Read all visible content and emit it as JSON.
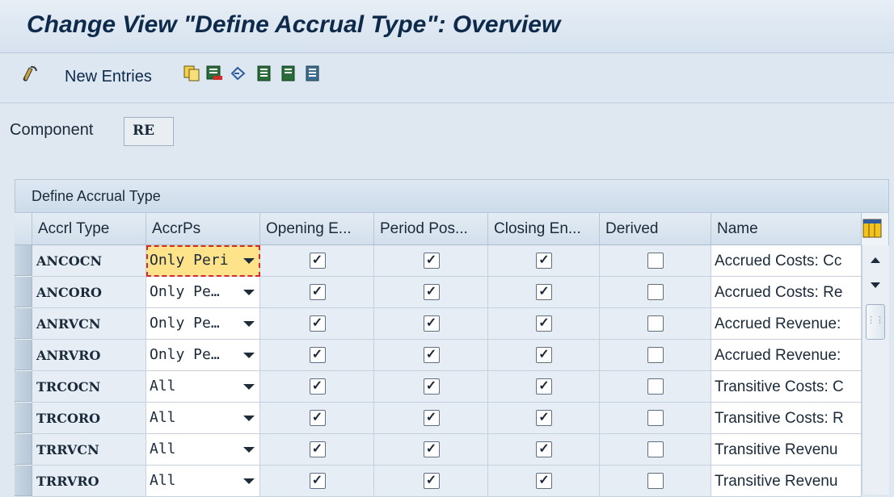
{
  "window": {
    "title": "Change View \"Define Accrual Type\": Overview"
  },
  "toolbar": {
    "new_entries_label": "New Entries",
    "icons": [
      "change-display-icon",
      "copy-icon",
      "delete-icon",
      "undo-change-icon",
      "select-all-icon",
      "select-block-icon",
      "deselect-all-icon"
    ]
  },
  "component": {
    "label": "Component",
    "value": "RE"
  },
  "table": {
    "title": "Define Accrual Type",
    "columns": [
      "Accrl Type",
      "AccrPs",
      "Opening E...",
      "Period Pos...",
      "Closing En...",
      "Derived",
      "Name"
    ],
    "rows": [
      {
        "type": "ANCOCN",
        "accrps": "Only Peri",
        "opening": true,
        "period": true,
        "closing": true,
        "derived": false,
        "name": "Accrued Costs: Cc"
      },
      {
        "type": "ANCORO",
        "accrps": "Only Pe…",
        "opening": true,
        "period": true,
        "closing": true,
        "derived": false,
        "name": "Accrued Costs: Re"
      },
      {
        "type": "ANRVCN",
        "accrps": "Only Pe…",
        "opening": true,
        "period": true,
        "closing": true,
        "derived": false,
        "name": "Accrued Revenue:"
      },
      {
        "type": "ANRVRO",
        "accrps": "Only Pe…",
        "opening": true,
        "period": true,
        "closing": true,
        "derived": false,
        "name": "Accrued Revenue:"
      },
      {
        "type": "TRCOCN",
        "accrps": "All",
        "opening": true,
        "period": true,
        "closing": true,
        "derived": false,
        "name": "Transitive Costs: C"
      },
      {
        "type": "TRCORO",
        "accrps": "All",
        "opening": true,
        "period": true,
        "closing": true,
        "derived": false,
        "name": "Transitive Costs: R"
      },
      {
        "type": "TRRVCN",
        "accrps": "All",
        "opening": true,
        "period": true,
        "closing": true,
        "derived": false,
        "name": "Transitive Revenu"
      },
      {
        "type": "TRRVRO",
        "accrps": "All",
        "opening": true,
        "period": true,
        "closing": true,
        "derived": false,
        "name": "Transitive Revenu"
      }
    ]
  },
  "colors": {
    "selected_cell": "#ffe38a",
    "selection_outline": "#d12b2b",
    "title_text": "#0e2a4a"
  }
}
